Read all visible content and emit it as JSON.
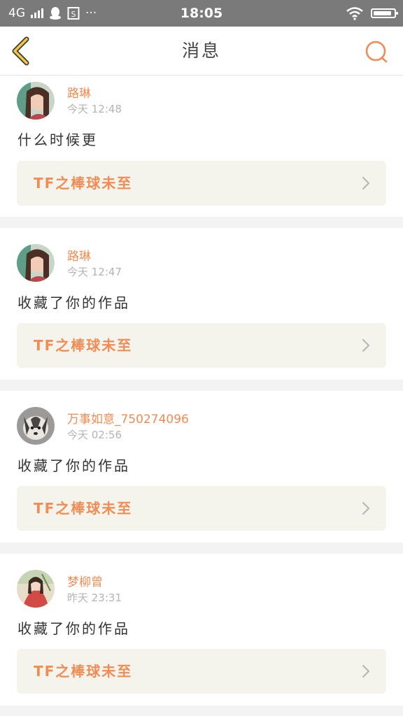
{
  "status_bar": {
    "network": "4G",
    "time": "18:05",
    "battery_level": 0.9,
    "icons": [
      "signal-icon",
      "qq-icon",
      "sim-icon",
      "more-icon",
      "wifi-icon",
      "battery-icon"
    ],
    "more": "···"
  },
  "nav": {
    "title": "消息",
    "accent_color": "#f08c54",
    "back_icon_color": "#f2c840",
    "icons": [
      "back-icon",
      "search-icon"
    ]
  },
  "messages": [
    {
      "username": "路琳",
      "time": "今天 12:48",
      "text": "什么时候更",
      "work_title": "TF之棒球未至"
    },
    {
      "username": "路琳",
      "time": "今天 12:47",
      "text": "收藏了你的作品",
      "work_title": "TF之棒球未至"
    },
    {
      "username": "万事如意_750274096",
      "time": "今天 02:56",
      "text": "收藏了你的作品",
      "work_title": "TF之棒球未至"
    },
    {
      "username": "梦柳曾",
      "time": "昨天 23:31",
      "text": "收藏了你的作品",
      "work_title": "TF之棒球未至"
    }
  ]
}
